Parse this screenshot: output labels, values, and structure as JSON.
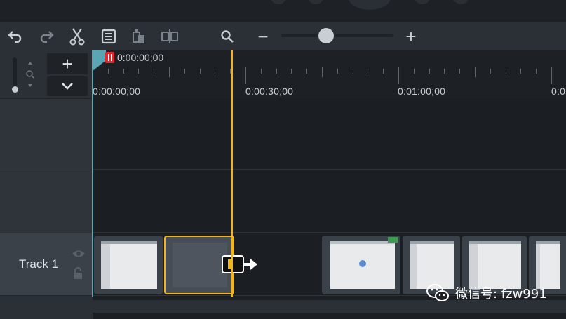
{
  "toolbar": {
    "undo_icon": "undo-icon",
    "redo_icon": "redo-icon",
    "cut_icon": "scissors-icon",
    "copy_icon": "copy-icon",
    "paste_icon": "paste-icon",
    "split_icon": "split-icon",
    "search_icon": "magnifier-icon",
    "zoom_out_label": "−",
    "zoom_in_label": "+",
    "zoom_level": 0.4
  },
  "track_controls": {
    "add_label": "+",
    "collapse_icon": "chevron-down-icon"
  },
  "playhead": {
    "time": "0:00:00;00"
  },
  "ruler": {
    "labels": [
      "0:00:00;00",
      "0:00:30;00",
      "0:01:00;00",
      "0:0"
    ]
  },
  "tracks": [
    {
      "name": ""
    },
    {
      "name": ""
    },
    {
      "name": "Track 1"
    }
  ],
  "watermark": {
    "text": "微信号: fzw991"
  },
  "colors": {
    "accent_yellow": "#f3b51a",
    "playhead_teal": "#5aa6b2",
    "playhead_red": "#e0282e",
    "background": "#1c2025"
  }
}
